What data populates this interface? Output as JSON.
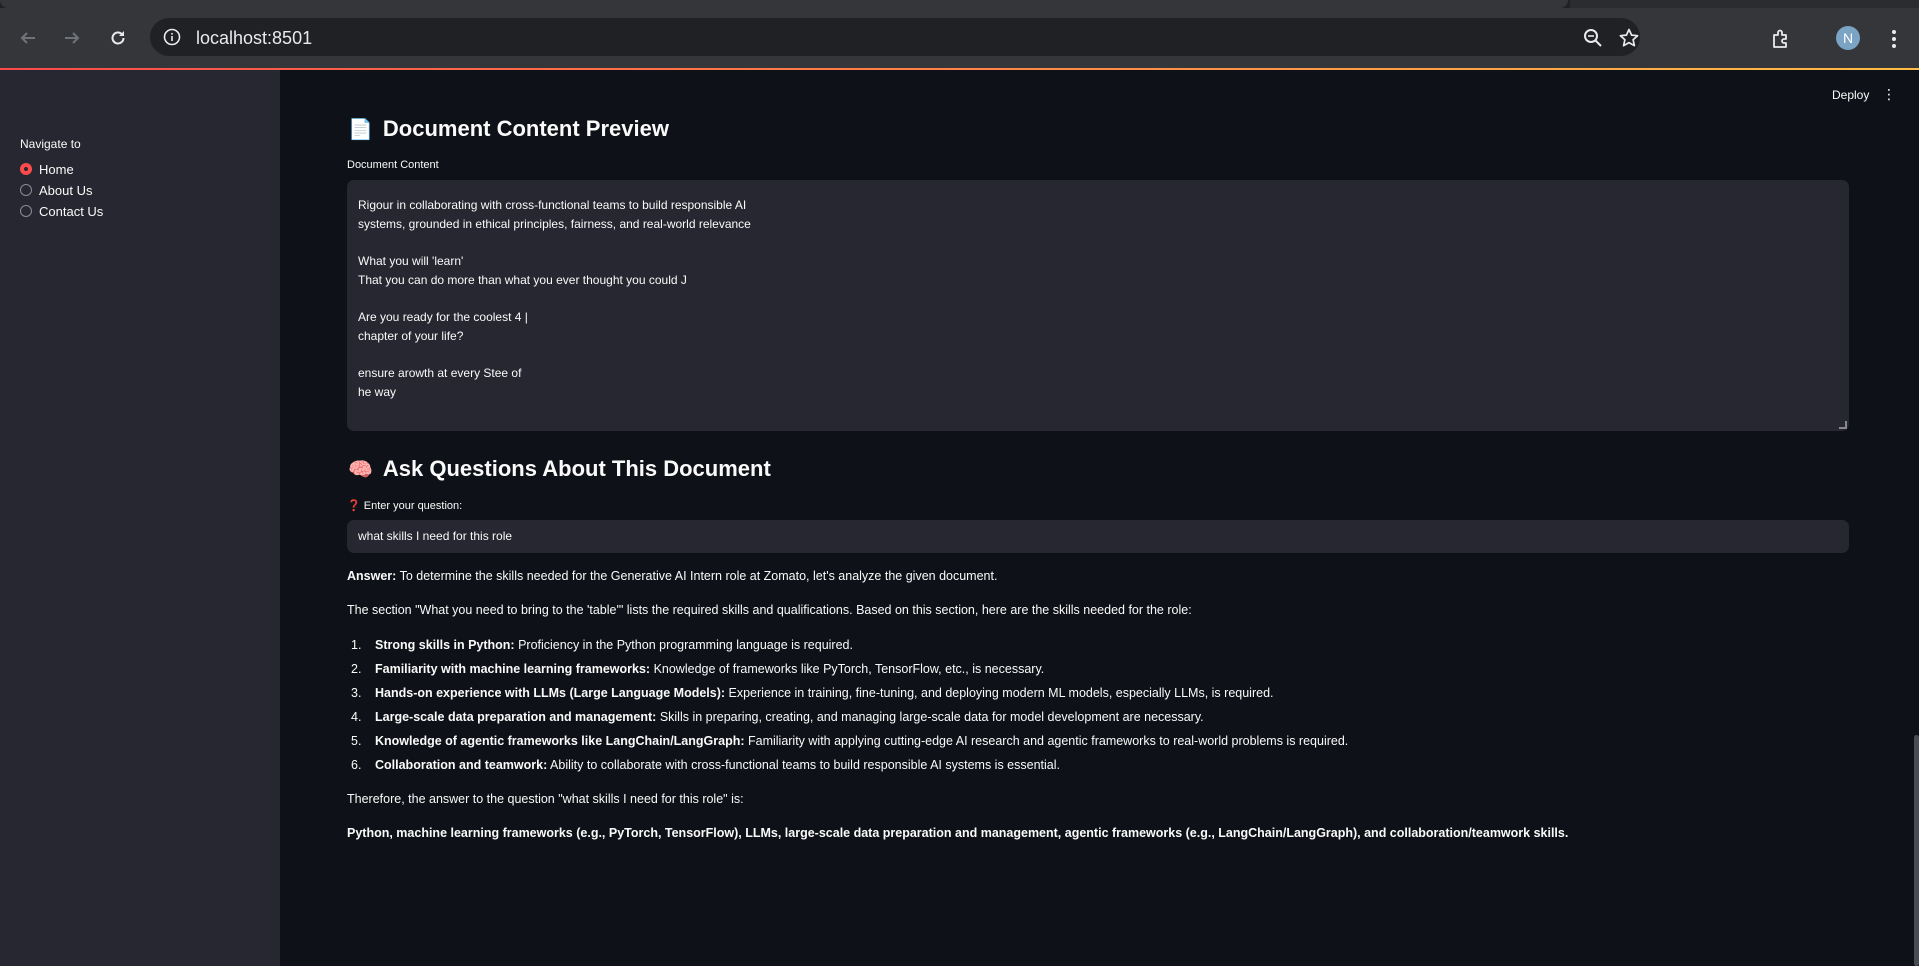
{
  "browser": {
    "url": "localhost:8501",
    "avatar_letter": "N"
  },
  "app": {
    "deploy_label": "Deploy",
    "menu_glyph": "⋮"
  },
  "sidebar": {
    "title": "Navigate to",
    "options": [
      {
        "label": "Home",
        "selected": true
      },
      {
        "label": "About Us",
        "selected": false
      },
      {
        "label": "Contact Us",
        "selected": false
      }
    ]
  },
  "preview": {
    "emoji": "📄",
    "title": "Document Content Preview",
    "field_label": "Document Content",
    "lines": [
      "Rigour in collaborating with cross-functional teams to build responsible AI",
      "systems, grounded in ethical principles, fairness, and real-world relevance",
      "",
      "What you will 'learn'",
      "That you can do more than what you ever thought you could J",
      "",
      "Are you ready for the coolest 4 |",
      "chapter of your life?",
      "",
      "ensure arowth at every Stee of",
      "he way"
    ]
  },
  "qa": {
    "emoji": "🧠",
    "title": "Ask Questions About This Document",
    "question_icon": "❓",
    "question_label": "Enter your question:",
    "question_value": "what skills I need for this role",
    "answer_label": "Answer:",
    "answer_intro": " To determine the skills needed for the Generative AI Intern role at Zomato, let's analyze the given document.",
    "section_text": "The section \"What you need to bring to the 'table'\" lists the required skills and qualifications. Based on this section, here are the skills needed for the role:",
    "skills": [
      {
        "num": "1.",
        "title": "Strong skills in Python:",
        "desc": " Proficiency in the Python programming language is required."
      },
      {
        "num": "2.",
        "title": "Familiarity with machine learning frameworks:",
        "desc": " Knowledge of frameworks like PyTorch, TensorFlow, etc., is necessary."
      },
      {
        "num": "3.",
        "title": "Hands-on experience with LLMs (Large Language Models):",
        "desc": " Experience in training, fine-tuning, and deploying modern ML models, especially LLMs, is required."
      },
      {
        "num": "4.",
        "title": "Large-scale data preparation and management:",
        "desc": " Skills in preparing, creating, and managing large-scale data for model development are necessary."
      },
      {
        "num": "5.",
        "title": "Knowledge of agentic frameworks like LangChain/LangGraph:",
        "desc": " Familiarity with applying cutting-edge AI research and agentic frameworks to real-world problems is required."
      },
      {
        "num": "6.",
        "title": "Collaboration and teamwork:",
        "desc": " Ability to collaborate with cross-functional teams to build responsible AI systems is essential."
      }
    ],
    "therefore_text": "Therefore, the answer to the question \"what skills I need for this role\" is:",
    "final_answer": "Python, machine learning frameworks (e.g., PyTorch, TensorFlow), LLMs, large-scale data preparation and management, agentic frameworks (e.g., LangChain/LangGraph), and collaboration/teamwork skills."
  },
  "colors": {
    "app_bg": "#0e1117",
    "sidebar_bg": "#262730",
    "accent": "#ff4b4b",
    "browser_bar": "#35363a"
  }
}
